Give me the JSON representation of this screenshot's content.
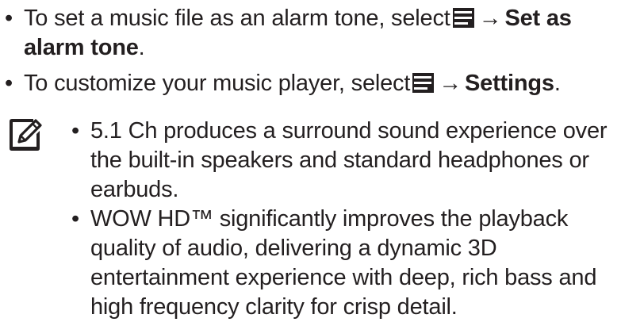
{
  "top_bullets": [
    {
      "bullet": "•",
      "prefix": "To set a music file as an alarm tone, select",
      "menu_icon": "menu-icon",
      "arrow": "→",
      "bold_line1": "Set as",
      "bold_line2": "alarm tone",
      "suffix": "."
    },
    {
      "bullet": "•",
      "prefix": "To customize your music player, select",
      "menu_icon": "menu-icon",
      "arrow": "→",
      "bold": "Settings",
      "suffix": "."
    }
  ],
  "note": {
    "icon": "note-pencil-icon",
    "bullets": [
      {
        "bullet": "•",
        "lines": [
          "5.1 Ch produces a surround sound experience over",
          "the built-in speakers and standard headphones or",
          "earbuds."
        ]
      },
      {
        "bullet": "•",
        "lines": [
          "WOW HD™ significantly improves the playback",
          "quality of audio, delivering a dynamic 3D",
          "entertainment experience with deep, rich bass and",
          "high frequency clarity for crisp detail."
        ]
      }
    ]
  }
}
